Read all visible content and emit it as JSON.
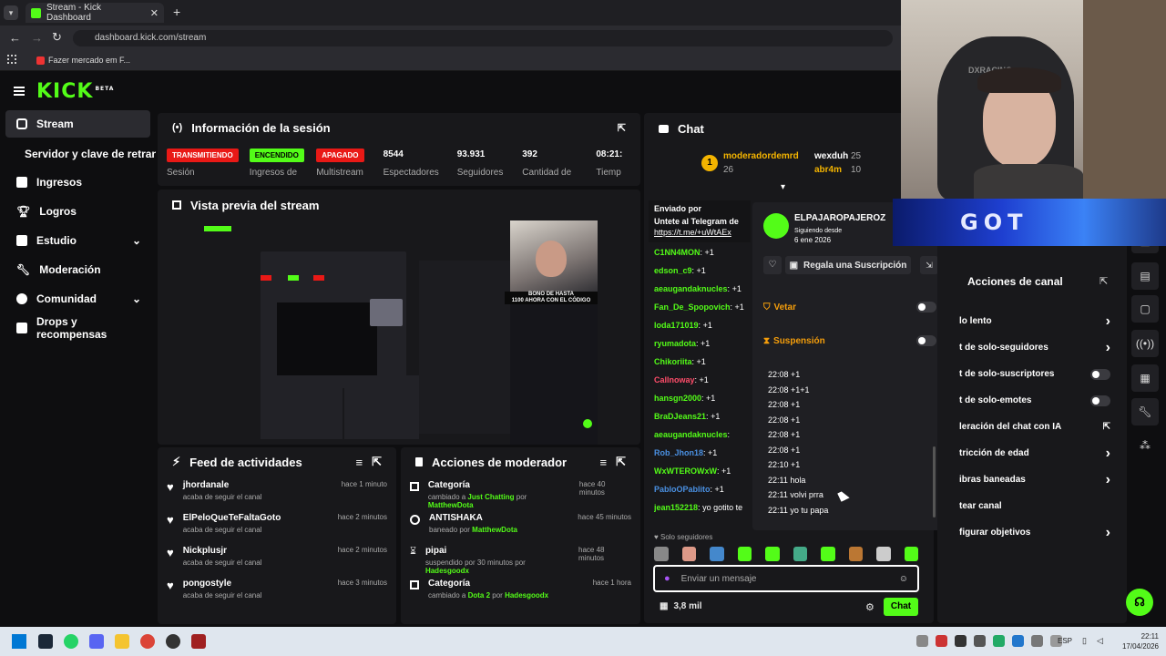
{
  "browser": {
    "tab_title": "Stream - Kick Dashboard",
    "url": "dashboard.kick.com/stream",
    "bookmark": "Fazer mercado em F..."
  },
  "app": {
    "logo": "KICK",
    "logo_beta": "BETA"
  },
  "sidebar": {
    "items": [
      {
        "label": "Stream"
      },
      {
        "label": "Servidor y clave de retransm"
      },
      {
        "label": "Ingresos"
      },
      {
        "label": "Logros"
      },
      {
        "label": "Estudio"
      },
      {
        "label": "Moderación"
      },
      {
        "label": "Comunidad"
      },
      {
        "label": "Drops y recompensas"
      }
    ]
  },
  "session": {
    "title": "Información de la sesión",
    "stats": [
      {
        "value": "TRANSMITIENDO",
        "label": "Sesión"
      },
      {
        "value": "ENCENDIDO",
        "label": "Ingresos de"
      },
      {
        "value": "APAGADO",
        "label": "Multistream"
      },
      {
        "value": "8544",
        "label": "Espectadores"
      },
      {
        "value": "93.931",
        "label": "Seguidores"
      },
      {
        "value": "392",
        "label": "Cantidad de"
      },
      {
        "value": "08:21:",
        "label": "Tiemp"
      }
    ]
  },
  "preview": {
    "title": "Vista previa del stream",
    "promo_line1": "BONO DE HASTA",
    "promo_line2": "1100 AHORA CON EL CÓDIGO"
  },
  "feed": {
    "title": "Feed de actividades",
    "items": [
      {
        "name": "jhordanale",
        "sub": "acaba de seguir el canal",
        "time": "hace 1 minuto"
      },
      {
        "name": "ElPeloQueTeFaltaGoto",
        "sub": "acaba de seguir el canal",
        "time": "hace 2 minutos"
      },
      {
        "name": "Nickplusjr",
        "sub": "acaba de seguir el canal",
        "time": "hace 2 minutos"
      },
      {
        "name": "pongostyle",
        "sub": "acaba de seguir el canal",
        "time": "hace 3 minutos"
      }
    ]
  },
  "modactions": {
    "title": "Acciones de moderador",
    "items": [
      {
        "name": "Categoría",
        "pre": "cambiado a",
        "target": "Just Chatting",
        "mid": "por",
        "by": "MatthewDota",
        "time": "hace 40 minutos"
      },
      {
        "name": "ANTISHAKA",
        "pre": "baneado por",
        "target": "MatthewDota",
        "mid": "",
        "by": "",
        "time": "hace 45 minutos"
      },
      {
        "name": "pipai",
        "pre": "suspendido por 30 minutos por",
        "target": "Hadesgoodx",
        "mid": "",
        "by": "",
        "time": "hace 48 minutos"
      },
      {
        "name": "Categoría",
        "pre": "cambiado a",
        "target": "Dota 2",
        "mid": "por",
        "by": "Hadesgoodx",
        "time": "hace 1 hora"
      }
    ]
  },
  "chat": {
    "title": "Chat",
    "top": {
      "rank": "1",
      "user1": "moderadordemrd",
      "count1": "26",
      "user2": "wexduh",
      "count2": "25",
      "user3": "abr4m",
      "count3": "10"
    },
    "pinned": {
      "label": "Enviado por",
      "text": "Untete al Telegram de",
      "link": "https://t.me/+uWtAEx"
    },
    "messages": [
      {
        "user": "C1NN4MON",
        "text": "+1",
        "color": "#53fc18"
      },
      {
        "user": "edson_c9",
        "text": "+1",
        "color": "#53fc18"
      },
      {
        "user": "aeaugandaknucles",
        "text": "+1",
        "color": "#53fc18"
      },
      {
        "user": "Fan_De_Spopovich",
        "text": "+1",
        "color": "#53fc18"
      },
      {
        "user": "loda171019",
        "text": "+1",
        "color": "#53fc18"
      },
      {
        "user": "ryumadota",
        "text": "+1",
        "color": "#53fc18"
      },
      {
        "user": "Chikoriita",
        "text": "+1",
        "color": "#53fc18"
      },
      {
        "user": "Callnoway",
        "text": "+1",
        "color": "#ff4d6a"
      },
      {
        "user": "hansgn2000",
        "text": "+1",
        "color": "#53fc18"
      },
      {
        "user": "BraDJeans21",
        "text": "+1",
        "color": "#53fc18"
      },
      {
        "user": "aeaugandaknucles",
        "text": "",
        "color": "#53fc18"
      },
      {
        "user": "Rob_Jhon18",
        "text": "+1",
        "color": "#4a90e2"
      },
      {
        "user": "WxWTEROWxW",
        "text": "+1",
        "color": "#53fc18"
      },
      {
        "user": "PabloOPablito",
        "text": "+1",
        "color": "#4a90e2"
      },
      {
        "user": "jean152218",
        "text": "yo gotito te",
        "color": "#53fc18"
      }
    ],
    "followers_only": "Solo seguidores",
    "input_placeholder": "Enviar un mensaje",
    "viewers": "3,8 mil",
    "send": "Chat"
  },
  "usercard": {
    "name": "ELPAJAROPAJEROZ",
    "following_label": "Siguiendo desde",
    "following_date": "6 ene 2026",
    "gift": "Regala una Suscripción",
    "veto": "Vetar",
    "suspension": "Suspensión",
    "log": [
      "22:08 +1",
      "22:08 +1+1",
      "22:08 +1",
      "22:08 +1",
      "22:08 +1",
      "22:08 +1",
      "22:10 +1",
      "22:11 hola",
      "22:11 volvi prra",
      "22:11 yo tu papa"
    ]
  },
  "channel_actions": {
    "title": "Acciones de canal",
    "items": [
      {
        "label": "lo lento",
        "control": "chevron"
      },
      {
        "label": "t de solo-seguidores",
        "control": "chevron"
      },
      {
        "label": "t de solo-suscriptores",
        "control": "toggle"
      },
      {
        "label": "t de solo-emotes",
        "control": "toggle"
      },
      {
        "label": "leración del chat con IA",
        "control": "external"
      },
      {
        "label": "tricción de edad",
        "control": "chevron"
      },
      {
        "label": "ibras baneadas",
        "control": "chevron"
      },
      {
        "label": "tear canal",
        "control": "none"
      },
      {
        "label": "figurar objetivos",
        "control": "chevron"
      }
    ]
  },
  "webcam": {
    "overlay_text": "GOT",
    "chair_text": "DXRACING"
  },
  "taskbar": {
    "lang": "ESP",
    "time": "22:11",
    "date": "17/04/2026"
  },
  "colors": {
    "accent": "#53fc18",
    "live": "#e91916",
    "panel": "#18181b"
  }
}
